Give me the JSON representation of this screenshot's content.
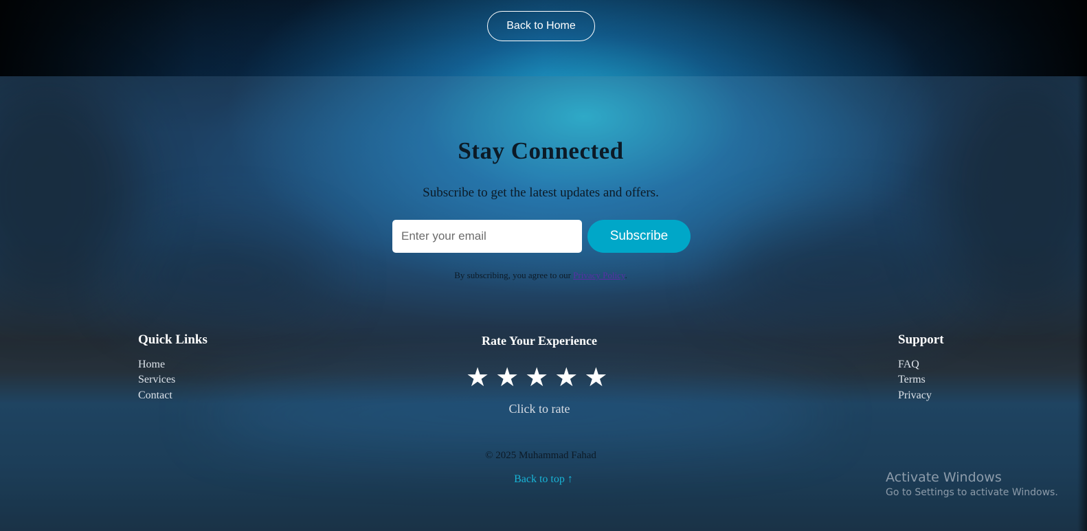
{
  "header": {
    "back_home_label": "Back to Home"
  },
  "newsletter": {
    "title": "Stay Connected",
    "subtitle": "Subscribe to get the latest updates and offers.",
    "email_placeholder": "Enter your email",
    "subscribe_label": "Subscribe",
    "agree_prefix": "By subscribing, you agree to our ",
    "privacy_link": "Privacy Policy",
    "agree_suffix": "."
  },
  "quick_links": {
    "title": "Quick Links",
    "items": [
      "Home",
      "Services",
      "Contact"
    ]
  },
  "rating": {
    "title": "Rate Your Experience",
    "stars": [
      "★",
      "★",
      "★",
      "★",
      "★"
    ],
    "hint": "Click to rate"
  },
  "support": {
    "title": "Support",
    "items": [
      "FAQ",
      "Terms",
      "Privacy"
    ]
  },
  "footer": {
    "copyright": "© 2025 Muhammad Fahad",
    "back_to_top": "Back to top ↑"
  },
  "os_watermark": {
    "line1": "Activate Windows",
    "line2": "Go to Settings to activate Windows."
  },
  "colors": {
    "accent": "#00a7c8",
    "link_accent": "#19b4d6",
    "privacy_link": "#5a2ea6"
  }
}
